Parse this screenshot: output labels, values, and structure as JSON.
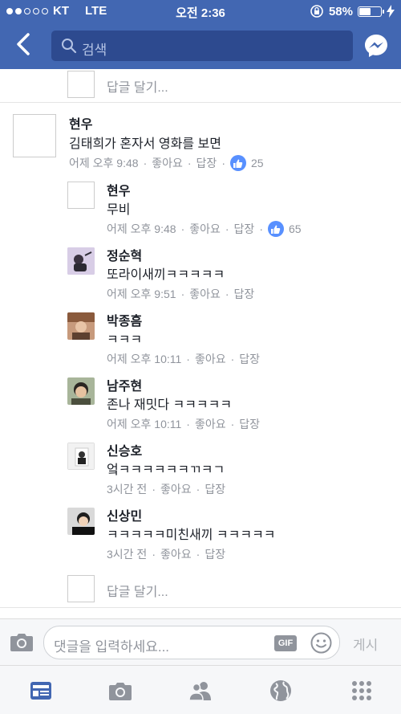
{
  "status_bar": {
    "carrier": "KT",
    "network": "LTE",
    "time": "오전 2:36",
    "battery": "58%",
    "battery_level": 0.58
  },
  "header": {
    "search_placeholder": "검색"
  },
  "thread": {
    "reply_prompt": "답글 달기...",
    "comment": {
      "name": "현우",
      "text": "김태희가 혼자서 영화를 보면",
      "time": "어제 오후 9:48",
      "like": "좋아요",
      "reply": "답장",
      "reactions": "25"
    },
    "replies": [
      {
        "name": "현우",
        "text": "무비",
        "time": "어제 오후 9:48",
        "like": "좋아요",
        "reply": "답장",
        "reactions": "65"
      },
      {
        "name": "정순혁",
        "text": "또라이새끼ㅋㅋㅋㅋㅋ",
        "time": "어제 오후 9:51",
        "like": "좋아요",
        "reply": "답장"
      },
      {
        "name": "박종흠",
        "text": "ㅋㅋㅋ",
        "time": "어제 오후 10:11",
        "like": "좋아요",
        "reply": "답장"
      },
      {
        "name": "남주현",
        "text": "존나 재밋다 ㅋㅋㅋㅋㅋ",
        "time": "어제 오후 10:11",
        "like": "좋아요",
        "reply": "답장"
      },
      {
        "name": "신승호",
        "text": "엌ㅋㅋㅋㅋㅋㅋㄲㅋㄱ",
        "time": "3시간 전",
        "like": "좋아요",
        "reply": "답장"
      },
      {
        "name": "신상민",
        "text": "ㅋㅋㅋㅋㅋ미친새끼 ㅋㅋㅋㅋㅋ",
        "time": "3시간 전",
        "like": "좋아요",
        "reply": "답장"
      }
    ]
  },
  "composer": {
    "placeholder": "댓글을 입력하세요...",
    "gif": "GIF",
    "post": "게시"
  },
  "tabs": [
    "news-feed-icon",
    "camera-icon",
    "friends-icon",
    "globe-icon",
    "more-icon"
  ],
  "colors": {
    "brand": "#4267b2",
    "like": "#5890ff",
    "muted": "#90949c"
  }
}
